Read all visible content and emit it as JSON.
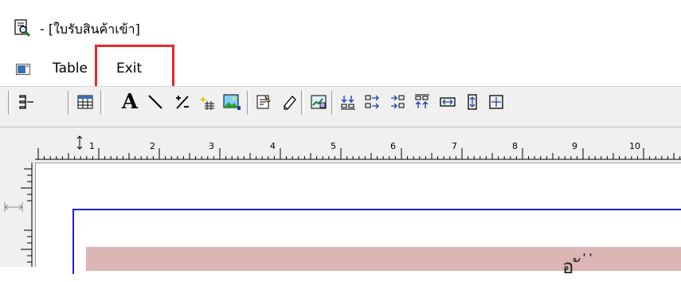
{
  "window": {
    "title": "- [ใบรับสินค้าเข้า]",
    "icon": "print-preview-icon"
  },
  "menu": {
    "items": [
      {
        "label": "Table"
      },
      {
        "label": "Exit"
      }
    ],
    "highlight_color": "#e8282a"
  },
  "toolbar": {
    "buttons": [
      {
        "icon": "align-lines-icon"
      },
      {
        "icon": "table-grid-icon"
      },
      {
        "icon": "text-tool-icon",
        "glyph": "A"
      },
      {
        "icon": "line-tool-icon"
      },
      {
        "icon": "formula-icon"
      },
      {
        "icon": "sparkle-field-icon"
      },
      {
        "icon": "image-insert-icon"
      },
      {
        "icon": "edit-properties-icon"
      },
      {
        "icon": "eraser-icon"
      },
      {
        "icon": "chart-icon"
      },
      {
        "icon": "align-bottom-icon"
      },
      {
        "icon": "align-center-icon"
      },
      {
        "icon": "align-right-icon"
      },
      {
        "icon": "align-top-icon"
      },
      {
        "icon": "same-width-icon"
      },
      {
        "icon": "same-height-icon"
      },
      {
        "icon": "same-size-icon"
      }
    ]
  },
  "ruler": {
    "numbers": [
      "1",
      "2",
      "3",
      "4",
      "5",
      "6",
      "7",
      "8",
      "9",
      "10"
    ]
  },
  "document": {
    "band_color": "#dcb5b5",
    "frame_color": "#2020e0",
    "partial_text": "อ ั ่ ่"
  }
}
